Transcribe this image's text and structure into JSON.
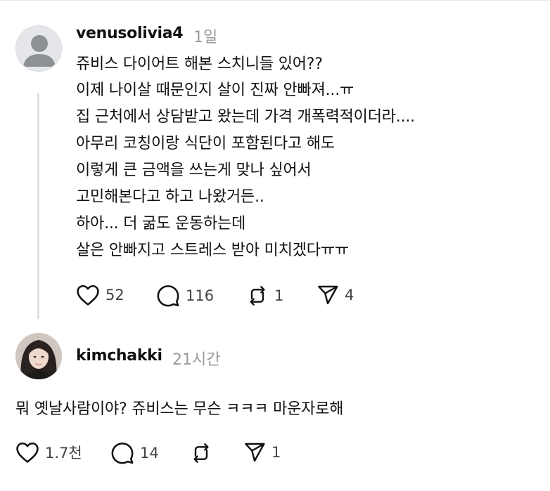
{
  "post": {
    "username": "venusolivia4",
    "time": "1일",
    "lines": [
      "쥬비스 다이어트 해본 스치니들 있어??",
      "이제 나이살 때문인지 살이 진짜 안빠져...ㅠ",
      "집 근처에서 상담받고 왔는데 가격 개폭력적이더라....",
      "아무리 코칭이랑 식단이 포함된다고 해도",
      "이렇게 큰 금액을 쓰는게 맞나 싶어서",
      "고민해본다고 하고 나왔거든..",
      "하아... 더 굶도 운동하는데",
      "살은 안빠지고 스트레스 받아 미치겠다ㅠㅠ"
    ],
    "actions": {
      "likes": "52",
      "comments": "116",
      "reposts": "1",
      "shares": "4"
    }
  },
  "reply": {
    "username": "kimchakki",
    "time": "21시간",
    "text": "뭐 옛날사람이야? 쥬비스는 무슨 ㅋㅋㅋ 마운자로해",
    "actions": {
      "likes": "1.7천",
      "comments": "14",
      "reposts": "",
      "shares": "1"
    }
  },
  "icons": {
    "like": "heart-icon",
    "comment": "comment-bubble-icon",
    "repost": "repost-icon",
    "share": "send-icon"
  },
  "colors": {
    "text": "#101010",
    "muted": "#9a9a9a",
    "line": "#e1e1e1"
  }
}
